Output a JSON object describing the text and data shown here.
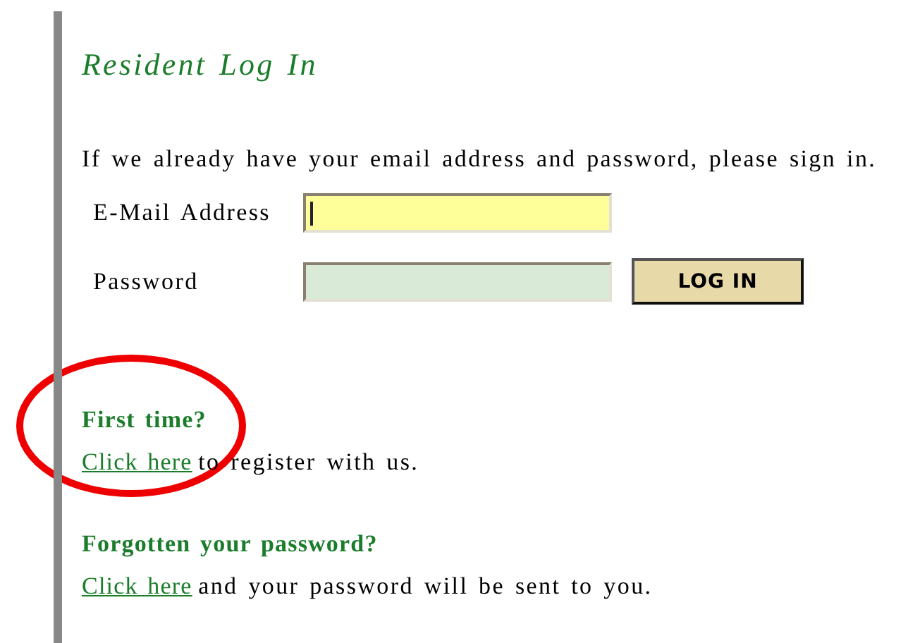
{
  "title": "Resident Log In",
  "intro": "If we already have your email address and password, please sign in.",
  "fields": [
    {
      "label": "E-Mail Address",
      "color": "#ffff99",
      "focused": true
    },
    {
      "label": "Password",
      "color": "#d9ead6",
      "focused": false
    }
  ],
  "login_button": "LOG IN",
  "help": [
    {
      "heading": "First time?",
      "link": "Click here",
      "text": "to register with us."
    },
    {
      "heading": "Forgotten your password?",
      "link": "Click here",
      "text": "and your password will be sent to you."
    }
  ],
  "annotations": [
    {
      "kind": "ellipse",
      "color": "#ee0000"
    }
  ]
}
